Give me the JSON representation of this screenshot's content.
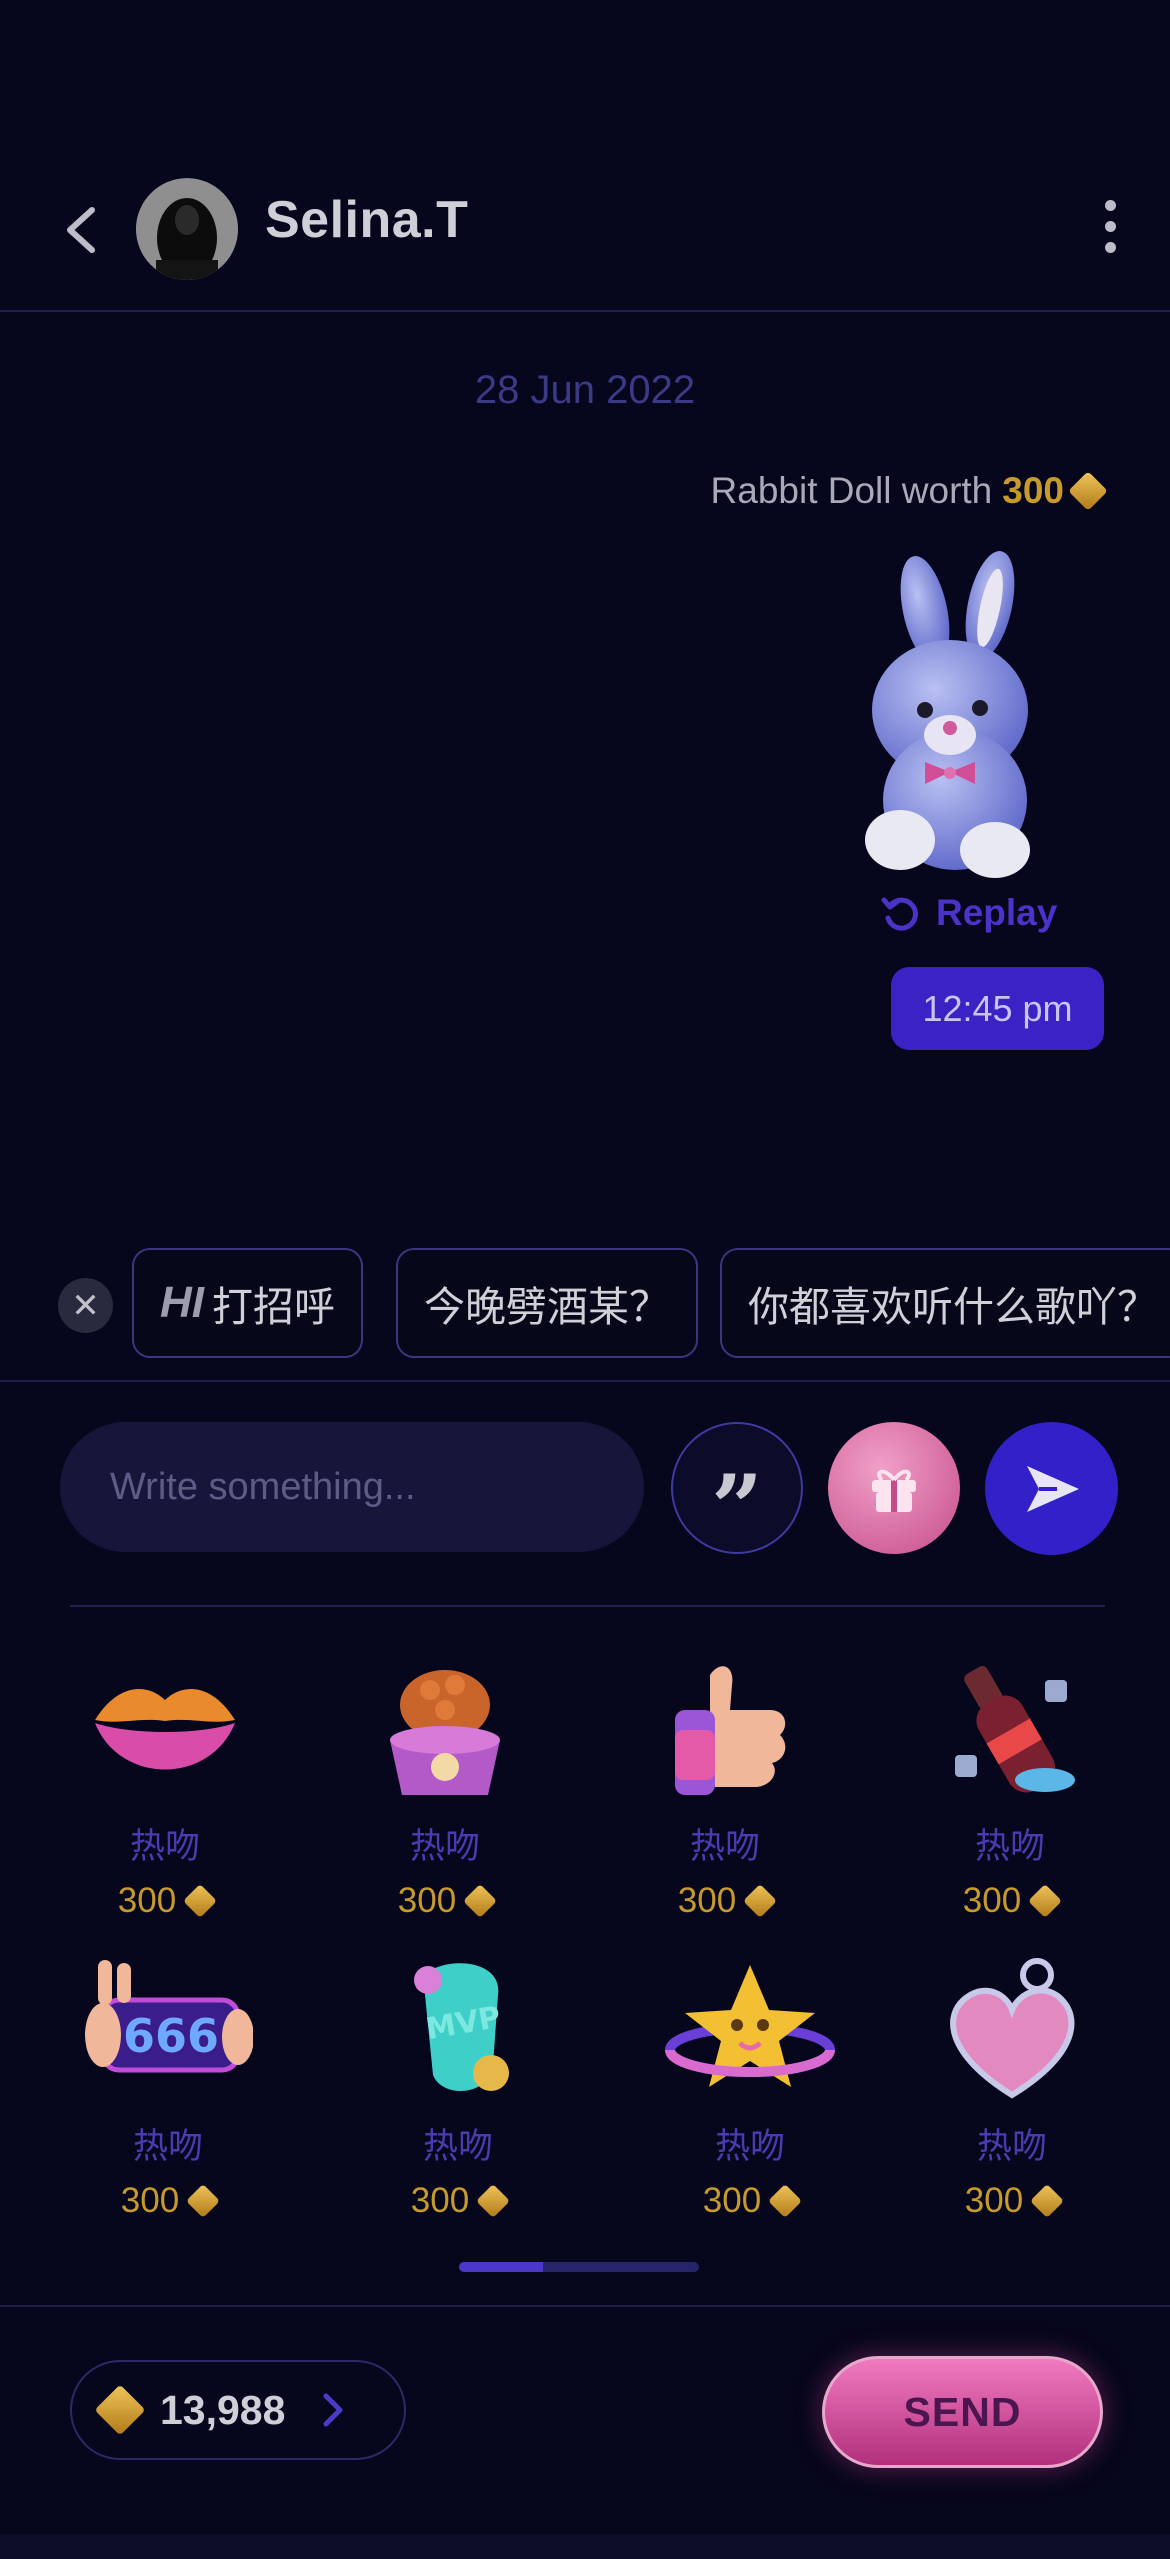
{
  "header": {
    "contact_name": "Selina.T"
  },
  "chat": {
    "date": "28 Jun 2022",
    "gift_message": {
      "prefix": "Rabbit Doll worth",
      "amount": "300"
    },
    "replay_label": "Replay",
    "time": "12:45 pm"
  },
  "quick_replies": {
    "hi_badge": "HI",
    "items": [
      "打招呼",
      "今晚劈酒某？",
      "你都喜欢听什么歌吖？"
    ]
  },
  "composer": {
    "placeholder": "Write something..."
  },
  "gifts": [
    {
      "label": "热吻",
      "price": "300",
      "icon": "lips-icon"
    },
    {
      "label": "热吻",
      "price": "300",
      "icon": "food-bowl-icon"
    },
    {
      "label": "热吻",
      "price": "300",
      "icon": "thumbs-up-icon"
    },
    {
      "label": "热吻",
      "price": "300",
      "icon": "cola-bottle-icon"
    },
    {
      "label": "热吻",
      "price": "300",
      "icon": "666-phone-icon"
    },
    {
      "label": "热吻",
      "price": "300",
      "icon": "mvp-balloon-icon"
    },
    {
      "label": "热吻",
      "price": "300",
      "icon": "star-planet-icon"
    },
    {
      "label": "热吻",
      "price": "300",
      "icon": "heart-charm-icon"
    }
  ],
  "pager": {
    "progress": 0.35
  },
  "footer": {
    "balance": "13,988",
    "send_label": "SEND"
  },
  "colors": {
    "background": "#06061c",
    "accent": "#3a22c5",
    "gold": "#c79a2c",
    "pink": "#d04e96"
  }
}
